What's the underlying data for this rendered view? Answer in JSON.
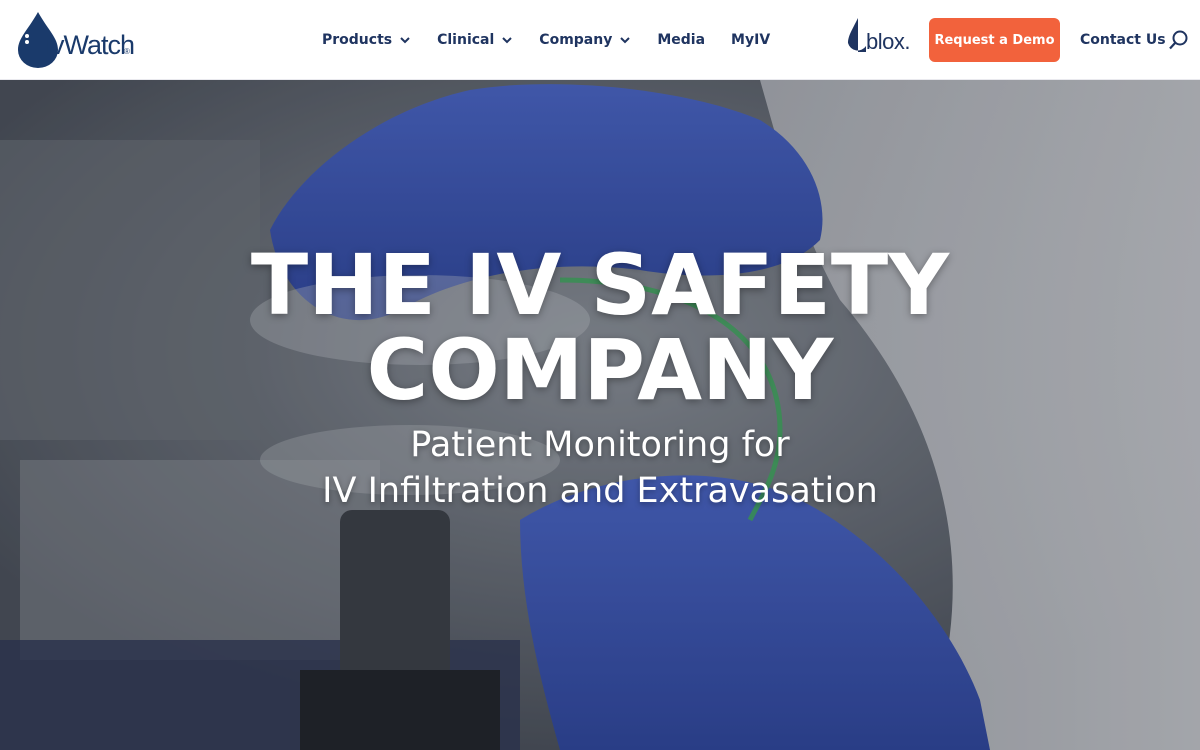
{
  "brand": {
    "name": "ivWatch",
    "reg_mark": "®"
  },
  "nav": {
    "items": [
      {
        "label": "Products",
        "has_dropdown": true
      },
      {
        "label": "Clinical",
        "has_dropdown": true
      },
      {
        "label": "Company",
        "has_dropdown": true
      },
      {
        "label": "Media",
        "has_dropdown": false
      },
      {
        "label": "MyIV",
        "has_dropdown": false
      }
    ]
  },
  "partner": {
    "name": "blox."
  },
  "actions": {
    "demo_label": "Request a Demo",
    "contact_label": "Contact Us",
    "search_icon": "search-icon"
  },
  "hero": {
    "title_line1": "THE IV SAFETY",
    "title_line2": "COMPANY",
    "subtitle_line1": "Patient Monitoring for",
    "subtitle_line2": "IV Infiltration and Extravasation"
  },
  "colors": {
    "navy": "#1f3460",
    "accent": "#f2623c",
    "glove_blue": "#3a56b8"
  }
}
